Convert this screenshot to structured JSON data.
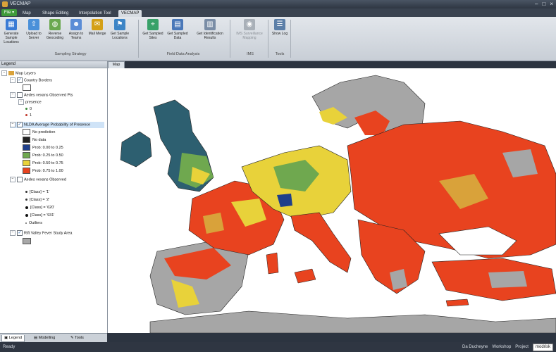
{
  "window": {
    "title": "VECMAP",
    "controls": [
      "–",
      "□",
      "×"
    ]
  },
  "ribbon_tabs": {
    "file": "File ▾",
    "tabs": [
      "Map",
      "Shape Editing",
      "Interpolation Tool",
      "VECMAP"
    ],
    "active": "VECMAP"
  },
  "ribbon": {
    "buttons": [
      {
        "label": "Generate Sample Locations",
        "icon": "grid-icon",
        "color": "#3a7bd5"
      },
      {
        "label": "Upload to Server",
        "icon": "upload-icon",
        "color": "#4a90d9"
      },
      {
        "label": "Reverse Geocoding",
        "icon": "globe-icon",
        "color": "#6aa84f"
      },
      {
        "label": "Assign to Teams",
        "icon": "people-icon",
        "color": "#5b8dd6"
      },
      {
        "label": "Mail Merge",
        "icon": "mail-icon",
        "color": "#d4a017"
      },
      {
        "label": "Get Sample Locations",
        "icon": "flag-icon",
        "color": "#3d85c6"
      },
      {
        "label": "Get Sampled Sites",
        "icon": "map-pin-icon",
        "color": "#38a169"
      },
      {
        "label": "Get Sampled Data",
        "icon": "table-icon",
        "color": "#4a78b8"
      },
      {
        "label": "Get Identification Results",
        "icon": "document-icon",
        "color": "#7a8da6"
      },
      {
        "label": "IMS Surveillance Mapping",
        "icon": "eye-icon",
        "color": "#a9b0b8"
      },
      {
        "label": "Show Log",
        "icon": "log-icon",
        "color": "#5c7fa8"
      }
    ],
    "groups": [
      "Sampling Strategy",
      "Field Data Analysis",
      "IMS",
      "Tools"
    ]
  },
  "legend": {
    "header": "Legend",
    "root": "Map Layers",
    "layers": [
      {
        "name": "Country Borders"
      },
      {
        "name": "Aedes vexans Observed Pts",
        "sub": "presence",
        "classes": [
          "0",
          "1"
        ]
      },
      {
        "name": "NLDA Average Probability of Presence",
        "classes": [
          "No prediction",
          "No data",
          "Prob: 0.00 to 0.25",
          "Prob: 0.25 to 0.50",
          "Prob: 0.50 to 0.75",
          "Prob: 0.75 to 1.00"
        ],
        "colors": [
          "#ffffff",
          "#222222",
          "#1f3f8a",
          "#6fa84f",
          "#e8d23a",
          "#e8431f"
        ]
      },
      {
        "name": "Aedes vexans Observed",
        "classes": [
          "[Class] = '1'",
          "[Class] = '2'",
          "[Class] = '620'",
          "[Class] = '931'",
          "Outliers"
        ]
      },
      {
        "name": "Rift Valley Fever Study Area"
      }
    ]
  },
  "bottom_tabs": [
    "Legend",
    "Modelling",
    "Tools"
  ],
  "map": {
    "tab": "Map"
  },
  "status": {
    "ready": "Ready",
    "user": "Da Ducheyne",
    "workshop": "Workshop",
    "project_label": "Project",
    "project_value": "modrisk"
  }
}
